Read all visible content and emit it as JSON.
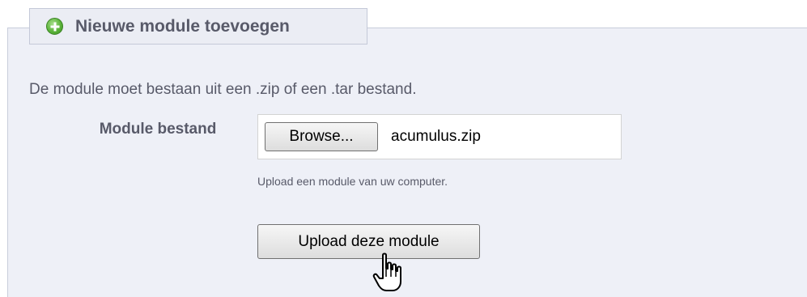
{
  "section": {
    "title": "Nieuwe module toevoegen",
    "icon": "plus-circle-icon",
    "icon_color": "#5bb33a"
  },
  "intro_text": "De module moet bestaan uit een .zip of een .tar bestand.",
  "field": {
    "label": "Module bestand",
    "browse_label": "Browse...",
    "file_name": "acumulus.zip",
    "hint": "Upload een module van uw computer."
  },
  "submit_label": "Upload deze module",
  "cursor": "hand-pointer-icon",
  "colors": {
    "panel_background": "#eef0f7",
    "text": "#585a69"
  }
}
